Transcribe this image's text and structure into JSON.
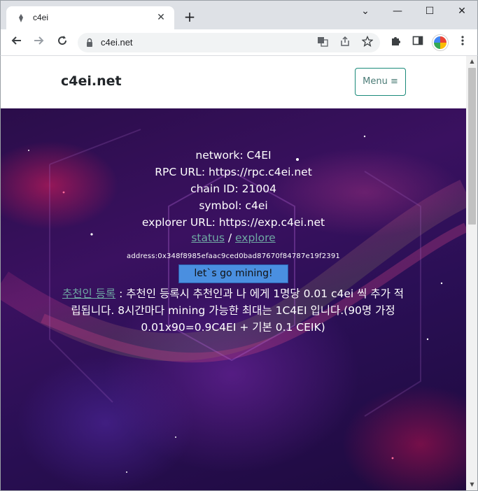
{
  "browser": {
    "tab_title": "c4ei",
    "tab_close": "✕",
    "new_tab": "+",
    "url": "c4ei.net",
    "window_controls": [
      "⌄",
      "—",
      "☐",
      "✕"
    ]
  },
  "site": {
    "brand": "c4ei.net",
    "menu_label": "Menu ≡"
  },
  "hero": {
    "lines": [
      "network: C4EI",
      "RPC URL: https://rpc.c4ei.net",
      "chain ID: 21004",
      "symbol: c4ei",
      "explorer URL: https://exp.c4ei.net"
    ],
    "status_link": "status",
    "separator": " / ",
    "explore_link": "explore",
    "address": "address:0x348f8985efaac9ced0bad87670f84787e19f2391",
    "mine_button": "let`s go mining!",
    "referral_link": "추천인 등록",
    "referral_text": " : 추천인 등록시 추천인과 나 에게 1명당 0.01 c4ei 씩 추가 적립됩니다. 8시간마다 mining 가능한 최대는 1C4EI 입니다.(90명 가정 0.01x90=0.9C4EI + 기본 0.1 CEIK)"
  },
  "icons": {
    "back": "back-arrow-icon",
    "forward": "forward-arrow-icon",
    "reload": "reload-icon",
    "lock": "lock-icon",
    "translate": "translate-icon",
    "share": "share-icon",
    "bookmark": "star-icon",
    "extensions": "puzzle-icon",
    "sidepanel": "sidepanel-icon",
    "more": "kebab-menu-icon"
  },
  "colors": {
    "link": "#6fa9a3",
    "button": "#4a8fe0",
    "menu_border": "#1a8a7a"
  }
}
